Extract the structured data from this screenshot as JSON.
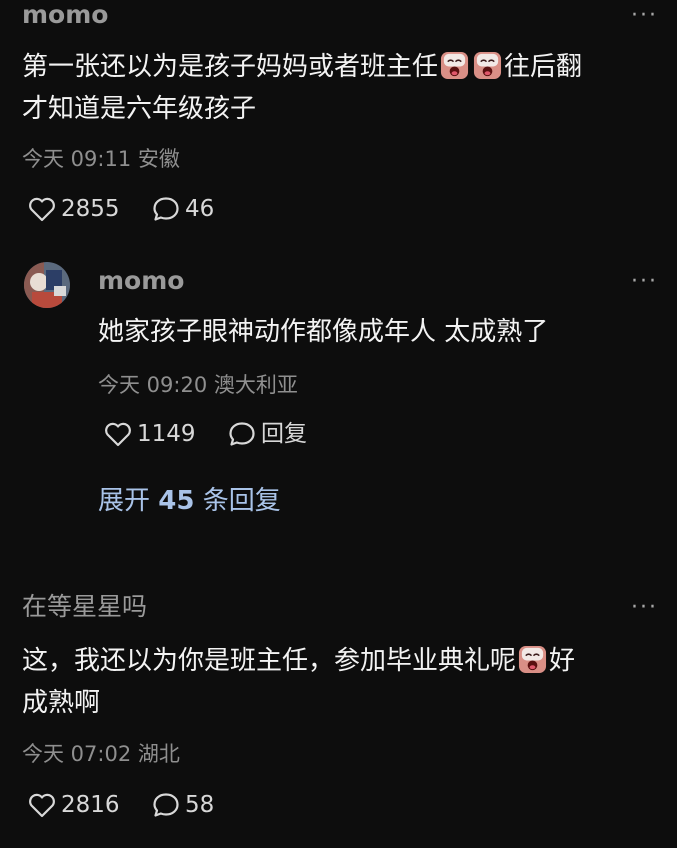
{
  "comments": [
    {
      "username": "momo",
      "text_line1_a": "第一张还以为是孩子妈妈或者班主任",
      "text_line1_b": "往后翻",
      "text_line2": "才知道是六年级孩子",
      "time": "今天 09:11",
      "location": "安徽",
      "likes": "2855",
      "replies": "46"
    },
    {
      "username": "momo",
      "text": "她家孩子眼神动作都像成年人 太成熟了",
      "time": "今天 09:20",
      "location": "澳大利亚",
      "likes": "1149",
      "reply_label": "回复",
      "expand_prefix": "展开",
      "expand_count": "45",
      "expand_suffix": "条回复"
    },
    {
      "username": "在等星星吗",
      "text_line1_a": "这，我还以为你是班主任，参加毕业典礼呢",
      "text_line1_b": "好",
      "text_line2": "成熟啊",
      "time": "今天 07:02",
      "location": "湖北",
      "likes": "2816",
      "replies": "58"
    }
  ],
  "more_glyph": "···",
  "icons": {
    "like": "heart-outline-icon",
    "comment": "speech-bubble-icon",
    "emoji": "crying-face-emoji"
  },
  "colors": {
    "background": "#0d0d0d",
    "text": "#f3f3f3",
    "meta": "#8f8f8f",
    "link": "#a9c3e8"
  }
}
